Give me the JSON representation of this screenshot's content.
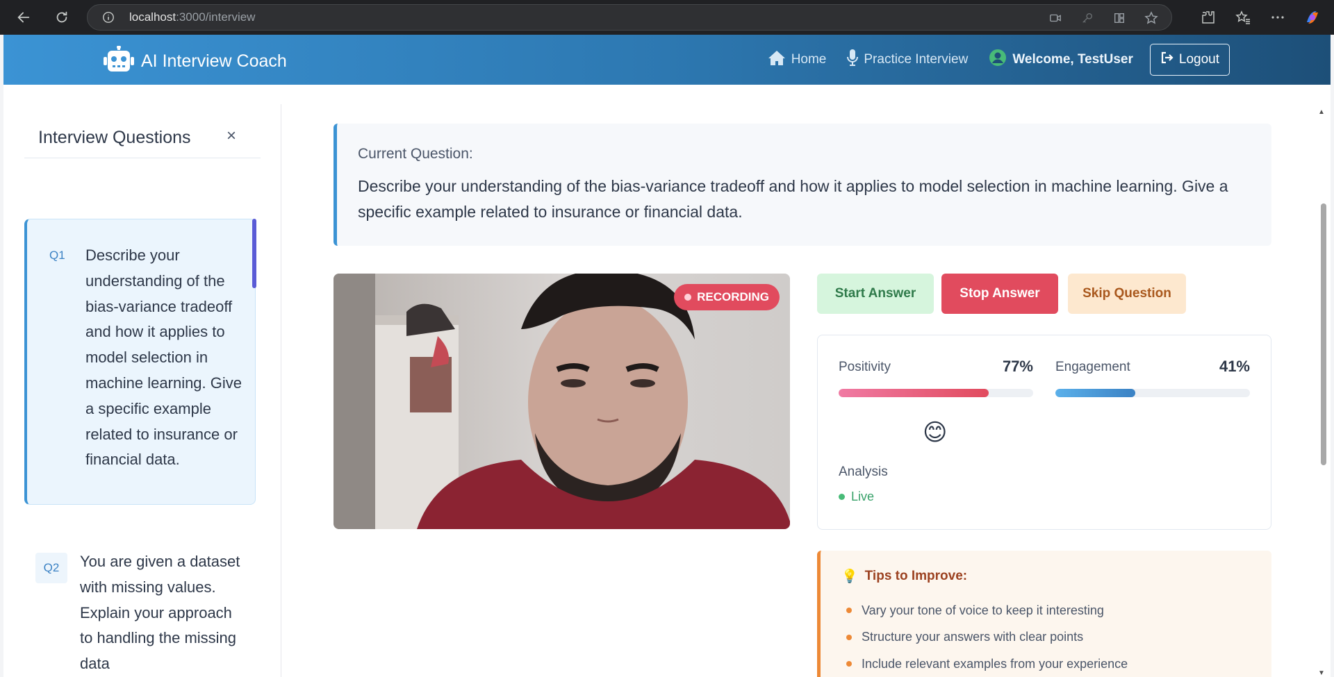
{
  "browser": {
    "url_host": "localhost",
    "url_path": ":3000/interview"
  },
  "navbar": {
    "brand": "AI Interview Coach",
    "links": {
      "home": "Home",
      "practice": "Practice Interview",
      "welcome": "Welcome, TestUser",
      "logout": "Logout"
    }
  },
  "sidebar": {
    "title": "Interview Questions",
    "close_glyph": "×",
    "questions": [
      {
        "num": "Q1",
        "text": "Describe your understanding of the bias-variance tradeoff and how it applies to model selection in machine learning.  Give a specific example related to insurance or financial data."
      },
      {
        "num": "Q2",
        "text": "You are given a dataset with missing values. Explain your approach to handling the missing data"
      }
    ]
  },
  "current_question": {
    "label": "Current Question:",
    "text": "Describe your understanding of the bias-variance tradeoff and how it applies to model selection in machine learning.  Give a specific example related to insurance or financial data."
  },
  "video": {
    "badge": "RECORDING"
  },
  "controls": {
    "start": "Start Answer",
    "stop": "Stop Answer",
    "skip": "Skip Question"
  },
  "metrics": {
    "positivity": {
      "label": "Positivity",
      "value_text": "77%",
      "value": 0.77
    },
    "engagement": {
      "label": "Engagement",
      "value_text": "41%",
      "value": 0.41
    },
    "emoji": "😊",
    "analysis_label": "Analysis",
    "status": "Live"
  },
  "tips": {
    "icon": "💡",
    "title": "Tips to Improve:",
    "items": [
      "Vary your tone of voice to keep it interesting",
      "Structure your answers with clear points",
      "Include relevant examples from your experience"
    ]
  },
  "colors": {
    "navbar_start": "#3b93d4",
    "navbar_end": "#1d4f78",
    "recording": "#e14b5e",
    "accent": "#3b93d4"
  }
}
